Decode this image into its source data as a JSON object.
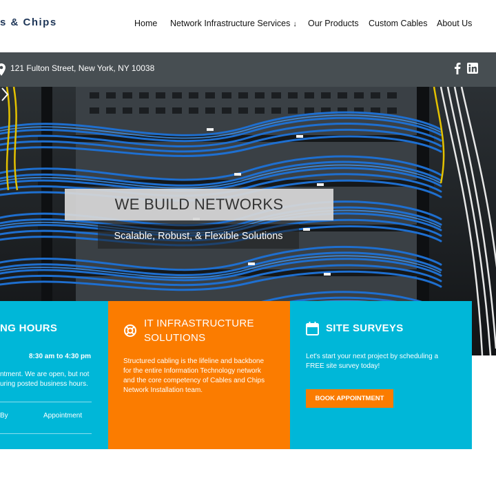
{
  "header": {
    "logo_text": "s & Chips",
    "nav": [
      {
        "label": "Home"
      },
      {
        "label": "Network Infrastructure Services",
        "arrow": "↓"
      },
      {
        "label": "Our Products"
      },
      {
        "label": "Custom Cables"
      },
      {
        "label": "About Us"
      }
    ]
  },
  "infobar": {
    "address": "121 Fulton Street, New York, NY 10038",
    "social": [
      "facebook-icon",
      "linkedin-icon"
    ]
  },
  "hero": {
    "title": "WE BUILD NETWORKS",
    "subtitle": "Scalable, Robust, & Flexible Solutions"
  },
  "cards": {
    "hours": {
      "title": "NG HOURS",
      "time": "8:30 am to 4:30 pm",
      "text_line1": "ntment. We are open, but not",
      "text_line2": "uring posted business hours.",
      "footer_left": "By",
      "footer_right": "Appointment"
    },
    "it": {
      "title_line1": "IT INFRASTRUCTURE",
      "title_line2": "SOLUTIONS",
      "text_lines": [
        "Structured cabling is the lifeline and backbone",
        "for the entire Information Technology network",
        "and the core competency of Cables and Chips",
        "Network Installation team."
      ]
    },
    "surveys": {
      "title": "SITE SURVEYS",
      "text_lines": [
        "Let's start your next project by scheduling a",
        "FREE site survey today!"
      ],
      "button": "BOOK APPOINTMENT"
    }
  },
  "colors": {
    "cyan": "#00b7d8",
    "orange": "#fb7c00",
    "infobar": "#474e52",
    "logo": "#1d3557"
  }
}
